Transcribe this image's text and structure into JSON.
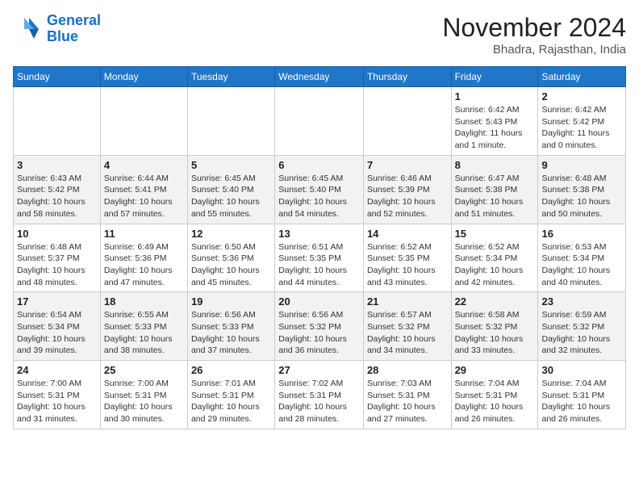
{
  "header": {
    "logo_line1": "General",
    "logo_line2": "Blue",
    "month": "November 2024",
    "location": "Bhadra, Rajasthan, India"
  },
  "weekdays": [
    "Sunday",
    "Monday",
    "Tuesday",
    "Wednesday",
    "Thursday",
    "Friday",
    "Saturday"
  ],
  "weeks": [
    [
      {
        "num": "",
        "detail": ""
      },
      {
        "num": "",
        "detail": ""
      },
      {
        "num": "",
        "detail": ""
      },
      {
        "num": "",
        "detail": ""
      },
      {
        "num": "",
        "detail": ""
      },
      {
        "num": "1",
        "detail": "Sunrise: 6:42 AM\nSunset: 5:43 PM\nDaylight: 11 hours\nand 1 minute."
      },
      {
        "num": "2",
        "detail": "Sunrise: 6:42 AM\nSunset: 5:42 PM\nDaylight: 11 hours\nand 0 minutes."
      }
    ],
    [
      {
        "num": "3",
        "detail": "Sunrise: 6:43 AM\nSunset: 5:42 PM\nDaylight: 10 hours\nand 58 minutes."
      },
      {
        "num": "4",
        "detail": "Sunrise: 6:44 AM\nSunset: 5:41 PM\nDaylight: 10 hours\nand 57 minutes."
      },
      {
        "num": "5",
        "detail": "Sunrise: 6:45 AM\nSunset: 5:40 PM\nDaylight: 10 hours\nand 55 minutes."
      },
      {
        "num": "6",
        "detail": "Sunrise: 6:45 AM\nSunset: 5:40 PM\nDaylight: 10 hours\nand 54 minutes."
      },
      {
        "num": "7",
        "detail": "Sunrise: 6:46 AM\nSunset: 5:39 PM\nDaylight: 10 hours\nand 52 minutes."
      },
      {
        "num": "8",
        "detail": "Sunrise: 6:47 AM\nSunset: 5:38 PM\nDaylight: 10 hours\nand 51 minutes."
      },
      {
        "num": "9",
        "detail": "Sunrise: 6:48 AM\nSunset: 5:38 PM\nDaylight: 10 hours\nand 50 minutes."
      }
    ],
    [
      {
        "num": "10",
        "detail": "Sunrise: 6:48 AM\nSunset: 5:37 PM\nDaylight: 10 hours\nand 48 minutes."
      },
      {
        "num": "11",
        "detail": "Sunrise: 6:49 AM\nSunset: 5:36 PM\nDaylight: 10 hours\nand 47 minutes."
      },
      {
        "num": "12",
        "detail": "Sunrise: 6:50 AM\nSunset: 5:36 PM\nDaylight: 10 hours\nand 45 minutes."
      },
      {
        "num": "13",
        "detail": "Sunrise: 6:51 AM\nSunset: 5:35 PM\nDaylight: 10 hours\nand 44 minutes."
      },
      {
        "num": "14",
        "detail": "Sunrise: 6:52 AM\nSunset: 5:35 PM\nDaylight: 10 hours\nand 43 minutes."
      },
      {
        "num": "15",
        "detail": "Sunrise: 6:52 AM\nSunset: 5:34 PM\nDaylight: 10 hours\nand 42 minutes."
      },
      {
        "num": "16",
        "detail": "Sunrise: 6:53 AM\nSunset: 5:34 PM\nDaylight: 10 hours\nand 40 minutes."
      }
    ],
    [
      {
        "num": "17",
        "detail": "Sunrise: 6:54 AM\nSunset: 5:34 PM\nDaylight: 10 hours\nand 39 minutes."
      },
      {
        "num": "18",
        "detail": "Sunrise: 6:55 AM\nSunset: 5:33 PM\nDaylight: 10 hours\nand 38 minutes."
      },
      {
        "num": "19",
        "detail": "Sunrise: 6:56 AM\nSunset: 5:33 PM\nDaylight: 10 hours\nand 37 minutes."
      },
      {
        "num": "20",
        "detail": "Sunrise: 6:56 AM\nSunset: 5:32 PM\nDaylight: 10 hours\nand 36 minutes."
      },
      {
        "num": "21",
        "detail": "Sunrise: 6:57 AM\nSunset: 5:32 PM\nDaylight: 10 hours\nand 34 minutes."
      },
      {
        "num": "22",
        "detail": "Sunrise: 6:58 AM\nSunset: 5:32 PM\nDaylight: 10 hours\nand 33 minutes."
      },
      {
        "num": "23",
        "detail": "Sunrise: 6:59 AM\nSunset: 5:32 PM\nDaylight: 10 hours\nand 32 minutes."
      }
    ],
    [
      {
        "num": "24",
        "detail": "Sunrise: 7:00 AM\nSunset: 5:31 PM\nDaylight: 10 hours\nand 31 minutes."
      },
      {
        "num": "25",
        "detail": "Sunrise: 7:00 AM\nSunset: 5:31 PM\nDaylight: 10 hours\nand 30 minutes."
      },
      {
        "num": "26",
        "detail": "Sunrise: 7:01 AM\nSunset: 5:31 PM\nDaylight: 10 hours\nand 29 minutes."
      },
      {
        "num": "27",
        "detail": "Sunrise: 7:02 AM\nSunset: 5:31 PM\nDaylight: 10 hours\nand 28 minutes."
      },
      {
        "num": "28",
        "detail": "Sunrise: 7:03 AM\nSunset: 5:31 PM\nDaylight: 10 hours\nand 27 minutes."
      },
      {
        "num": "29",
        "detail": "Sunrise: 7:04 AM\nSunset: 5:31 PM\nDaylight: 10 hours\nand 26 minutes."
      },
      {
        "num": "30",
        "detail": "Sunrise: 7:04 AM\nSunset: 5:31 PM\nDaylight: 10 hours\nand 26 minutes."
      }
    ]
  ]
}
